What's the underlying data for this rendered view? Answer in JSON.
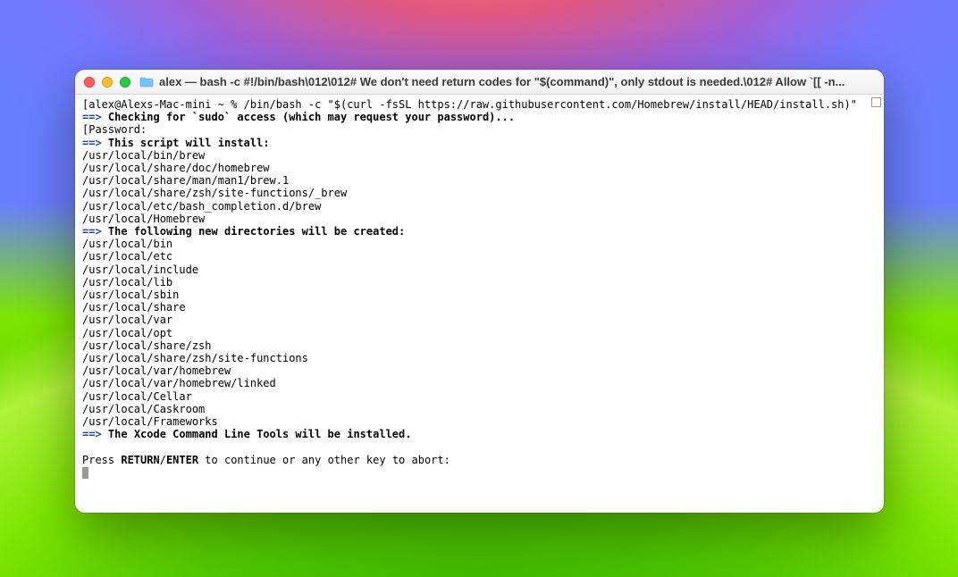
{
  "window": {
    "title": "alex — bash -c #!/bin/bash\\012\\012# We don't need return codes for \"$(command)\", only stdout is needed.\\012# Allow `[[ -n..."
  },
  "terminal": {
    "prompt_line": "[alex@Alexs-Mac-mini ~ % /bin/bash -c \"$(curl -fsSL https://raw.githubusercontent.com/Homebrew/install/HEAD/install.sh)\"",
    "arrow": "==>",
    "checking_sudo": "Checking for `sudo` access (which may request your password)...",
    "password_label": "[Password:",
    "this_script_install": "This script will install:",
    "install_paths": [
      "/usr/local/bin/brew",
      "/usr/local/share/doc/homebrew",
      "/usr/local/share/man/man1/brew.1",
      "/usr/local/share/zsh/site-functions/_brew",
      "/usr/local/etc/bash_completion.d/brew",
      "/usr/local/Homebrew"
    ],
    "new_dirs_heading": "The following new directories will be created:",
    "new_dirs": [
      "/usr/local/bin",
      "/usr/local/etc",
      "/usr/local/include",
      "/usr/local/lib",
      "/usr/local/sbin",
      "/usr/local/share",
      "/usr/local/var",
      "/usr/local/opt",
      "/usr/local/share/zsh",
      "/usr/local/share/zsh/site-functions",
      "/usr/local/var/homebrew",
      "/usr/local/var/homebrew/linked",
      "/usr/local/Cellar",
      "/usr/local/Caskroom",
      "/usr/local/Frameworks"
    ],
    "xcode_line": "The Xcode Command Line Tools will be installed.",
    "press_prefix": "Press ",
    "return_word": "RETURN",
    "slash": "/",
    "enter_word": "ENTER",
    "press_suffix": " to continue or any other key to abort:"
  }
}
